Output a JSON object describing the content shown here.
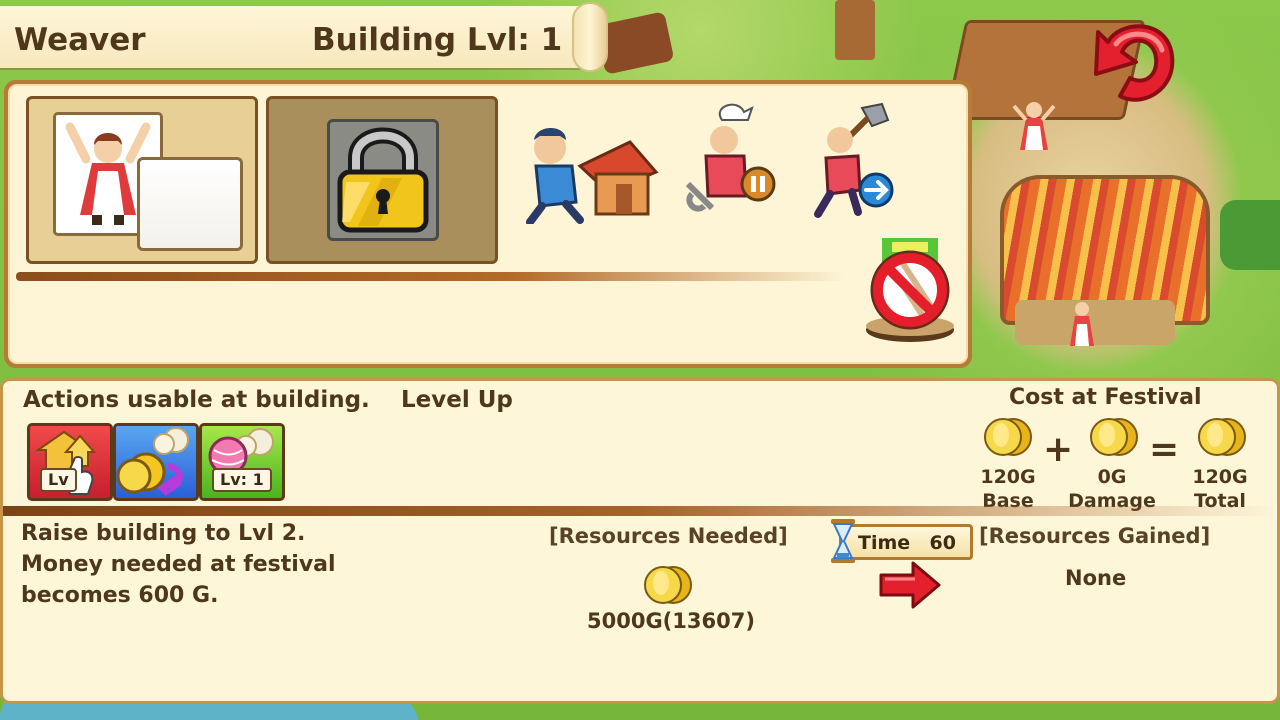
{
  "header": {
    "building_name": "Weaver",
    "level_text": "Building Lvl: 1"
  },
  "top_panel": {
    "action_icons": [
      "build-house-icon",
      "pause-worker-icon",
      "move-worker-icon"
    ],
    "lock_icon": "padlock-icon",
    "cancel_icon": "no-entry-icon"
  },
  "bottom_panel": {
    "actions_label": "Actions usable at building.",
    "selected_action": "Level Up",
    "action_buttons": [
      {
        "name": "level-up",
        "tag": "Lv",
        "color": "#e0303a"
      },
      {
        "name": "sell-materials",
        "tag": "",
        "color": "#3a78e0"
      },
      {
        "name": "upgrade-yarn",
        "tag": "Lv: 1",
        "color": "#6ccb2a"
      }
    ],
    "festival": {
      "title": "Cost at Festival",
      "plus": "+",
      "equals": "=",
      "base": {
        "value": "120G",
        "caption": "Base"
      },
      "damage": {
        "value": "0G",
        "caption": "Damage"
      },
      "total": {
        "value": "120G",
        "caption": "Total"
      }
    },
    "description": [
      "Raise building to Lvl 2.",
      "Money needed at festival",
      "becomes 600 G."
    ],
    "resources_needed_label": "[Resources Needed]",
    "resources_needed_value": "5000G(13607)",
    "time_label": "Time",
    "time_value": "60",
    "resources_gained_label": "[Resources Gained]",
    "resources_gained_value": "None"
  },
  "colors": {
    "panel_bg": "#fdf6d8",
    "panel_border": "#c79549",
    "text_brown": "#4f371b",
    "coin_gold": "#f3c622",
    "back_red": "#e02834"
  }
}
